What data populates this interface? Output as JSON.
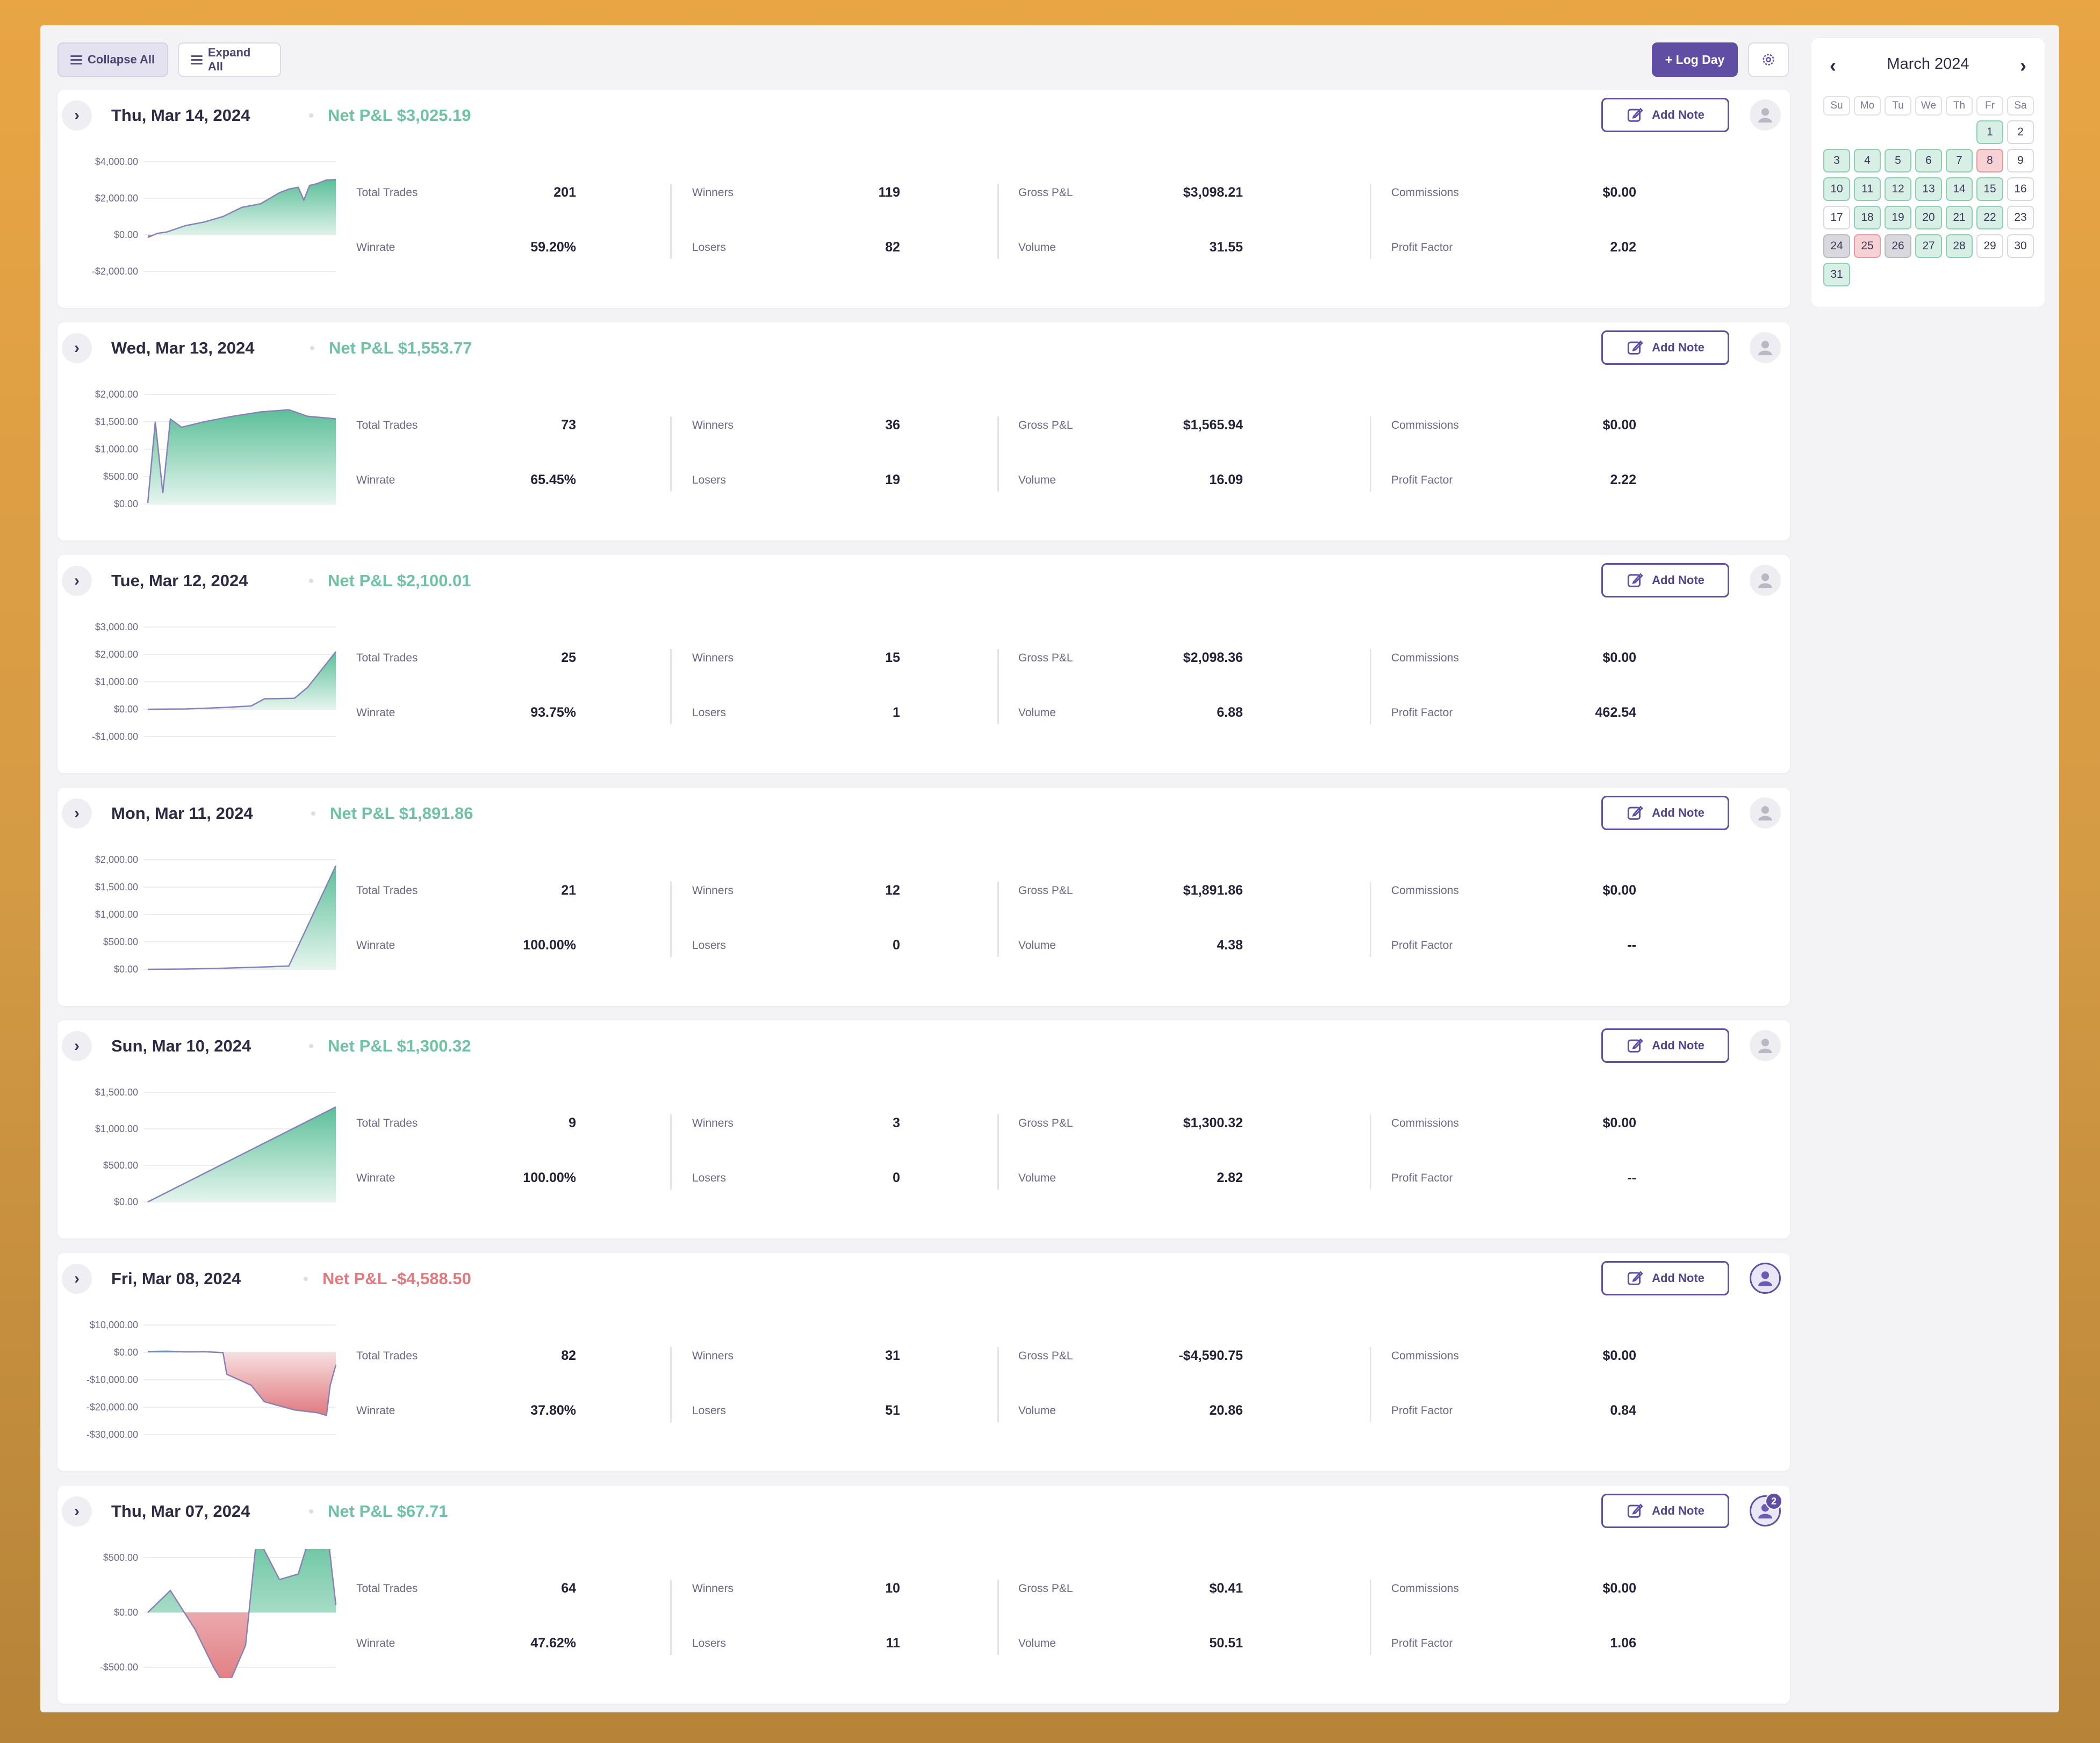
{
  "toolbar": {
    "collapse_label": "Collapse All",
    "expand_label": "Expand All",
    "log_day_label": "+ Log Day"
  },
  "stat_labels": {
    "total_trades": "Total Trades",
    "winrate": "Winrate",
    "winners": "Winners",
    "losers": "Losers",
    "gross_pnl": "Gross P&L",
    "volume": "Volume",
    "commissions": "Commissions",
    "profit_factor": "Profit Factor"
  },
  "note_label": "Add Note",
  "days": [
    {
      "date": "Thu, Mar 14, 2024",
      "net_pnl": "Net P&L $3,025.19",
      "sign": "pos",
      "total_trades": "201",
      "winrate": "59.20%",
      "winners": "119",
      "losers": "82",
      "gross_pnl": "$3,098.21",
      "volume": "31.55",
      "commissions": "$0.00",
      "profit_factor": "2.02",
      "chart": {
        "ticks": [
          "$4,000.00",
          "$2,000.00",
          "$0.00",
          "-$2,000.00"
        ],
        "yrange": [
          -2000,
          4000
        ]
      }
    },
    {
      "date": "Wed, Mar 13, 2024",
      "net_pnl": "Net P&L $1,553.77",
      "sign": "pos",
      "total_trades": "73",
      "winrate": "65.45%",
      "winners": "36",
      "losers": "19",
      "gross_pnl": "$1,565.94",
      "volume": "16.09",
      "commissions": "$0.00",
      "profit_factor": "2.22",
      "chart": {
        "ticks": [
          "$2,000.00",
          "$1,500.00",
          "$1,000.00",
          "$500.00",
          "$0.00"
        ],
        "yrange": [
          0,
          2000
        ]
      }
    },
    {
      "date": "Tue, Mar 12, 2024",
      "net_pnl": "Net P&L $2,100.01",
      "sign": "pos",
      "total_trades": "25",
      "winrate": "93.75%",
      "winners": "15",
      "losers": "1",
      "gross_pnl": "$2,098.36",
      "volume": "6.88",
      "commissions": "$0.00",
      "profit_factor": "462.54",
      "chart": {
        "ticks": [
          "$3,000.00",
          "$2,000.00",
          "$1,000.00",
          "$0.00",
          "-$1,000.00"
        ],
        "yrange": [
          -1000,
          3000
        ]
      }
    },
    {
      "date": "Mon, Mar 11, 2024",
      "net_pnl": "Net P&L $1,891.86",
      "sign": "pos",
      "total_trades": "21",
      "winrate": "100.00%",
      "winners": "12",
      "losers": "0",
      "gross_pnl": "$1,891.86",
      "volume": "4.38",
      "commissions": "$0.00",
      "profit_factor": "--",
      "chart": {
        "ticks": [
          "$2,000.00",
          "$1,500.00",
          "$1,000.00",
          "$500.00",
          "$0.00"
        ],
        "yrange": [
          0,
          2000
        ]
      }
    },
    {
      "date": "Sun, Mar 10, 2024",
      "net_pnl": "Net P&L $1,300.32",
      "sign": "pos",
      "total_trades": "9",
      "winrate": "100.00%",
      "winners": "3",
      "losers": "0",
      "gross_pnl": "$1,300.32",
      "volume": "2.82",
      "commissions": "$0.00",
      "profit_factor": "--",
      "chart": {
        "ticks": [
          "$1,500.00",
          "$1,000.00",
          "$500.00",
          "$0.00"
        ],
        "yrange": [
          0,
          1500
        ]
      }
    },
    {
      "date": "Fri, Mar 08, 2024",
      "net_pnl": "Net P&L -$4,588.50",
      "sign": "neg",
      "total_trades": "82",
      "winrate": "37.80%",
      "winners": "31",
      "losers": "51",
      "gross_pnl": "-$4,590.75",
      "volume": "20.86",
      "commissions": "$0.00",
      "profit_factor": "0.84",
      "chart": {
        "ticks": [
          "$10,000.00",
          "$0.00",
          "-$10,000.00",
          "-$20,000.00",
          "-$30,000.00"
        ],
        "yrange": [
          -30000,
          10000
        ]
      }
    },
    {
      "date": "Thu, Mar 07, 2024",
      "net_pnl": "Net P&L $67.71",
      "sign": "pos",
      "total_trades": "64",
      "winrate": "47.62%",
      "winners": "10",
      "losers": "11",
      "gross_pnl": "$0.41",
      "volume": "50.51",
      "commissions": "$0.00",
      "profit_factor": "1.06",
      "chart": {
        "ticks": [
          "$500.00",
          "$0.00",
          "-$500.00"
        ],
        "yrange": [
          -500,
          500
        ]
      }
    }
  ],
  "calendar": {
    "title": "March 2024",
    "weekdays": [
      "Su",
      "Mo",
      "Tu",
      "We",
      "Th",
      "Fr",
      "Sa"
    ],
    "first_weekday": 5,
    "days": [
      {
        "d": "1",
        "s": "g"
      },
      {
        "d": "2",
        "s": ""
      },
      {
        "d": "3",
        "s": "g"
      },
      {
        "d": "4",
        "s": "g"
      },
      {
        "d": "5",
        "s": "g"
      },
      {
        "d": "6",
        "s": "g"
      },
      {
        "d": "7",
        "s": "g"
      },
      {
        "d": "8",
        "s": "r"
      },
      {
        "d": "9",
        "s": ""
      },
      {
        "d": "10",
        "s": "g"
      },
      {
        "d": "11",
        "s": "g"
      },
      {
        "d": "12",
        "s": "g"
      },
      {
        "d": "13",
        "s": "g"
      },
      {
        "d": "14",
        "s": "g"
      },
      {
        "d": "15",
        "s": "g"
      },
      {
        "d": "16",
        "s": ""
      },
      {
        "d": "17",
        "s": ""
      },
      {
        "d": "18",
        "s": "g"
      },
      {
        "d": "19",
        "s": "g"
      },
      {
        "d": "20",
        "s": "g"
      },
      {
        "d": "21",
        "s": "g"
      },
      {
        "d": "22",
        "s": "g"
      },
      {
        "d": "23",
        "s": ""
      },
      {
        "d": "24",
        "s": "x"
      },
      {
        "d": "25",
        "s": "r"
      },
      {
        "d": "26",
        "s": "x"
      },
      {
        "d": "27",
        "s": "g"
      },
      {
        "d": "28",
        "s": "g"
      },
      {
        "d": "29",
        "s": ""
      },
      {
        "d": "30",
        "s": ""
      },
      {
        "d": "31",
        "s": "g"
      }
    ]
  },
  "colors": {
    "accent": "#5f4ea3",
    "positive": "#6fc3a4",
    "negative": "#e07a7f"
  },
  "icons": {
    "toolbar": [
      "list-icon",
      "gear-icon"
    ],
    "card": [
      "chevron-right-icon",
      "edit-icon",
      "avatar-icon"
    ]
  },
  "avatar_badge_count": "2"
}
